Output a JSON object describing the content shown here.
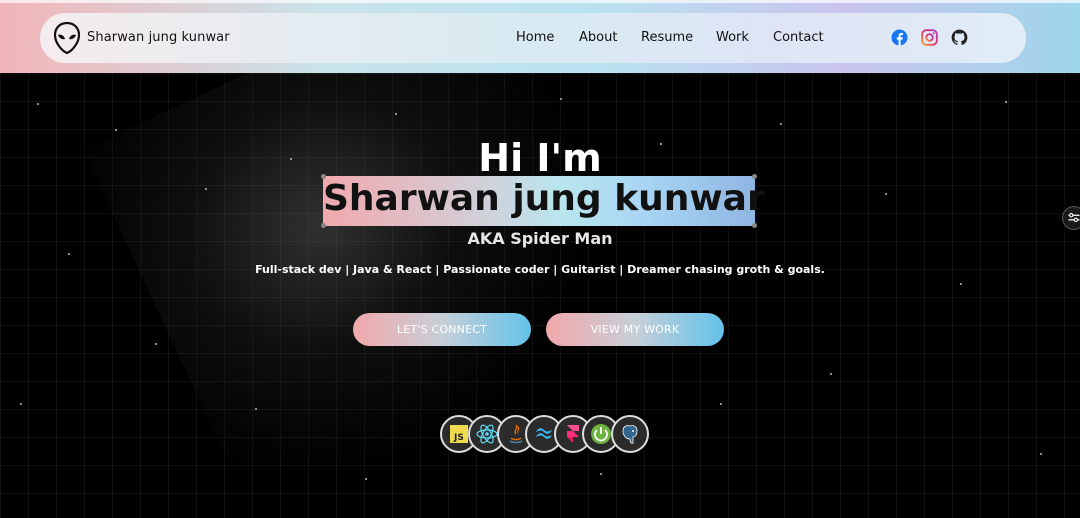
{
  "header": {
    "brand": "Sharwan jung kunwar",
    "nav": [
      "Home",
      "About",
      "Resume",
      "Work",
      "Contact"
    ],
    "social": [
      "facebook-icon",
      "instagram-icon",
      "github-icon"
    ]
  },
  "hero": {
    "greeting": "Hi I'm",
    "name": "Sharwan jung kunwar",
    "aka": "AKA Spider Man",
    "tagline": "Full-stack dev | Java & React | Passionate coder | Guitarist | Dreamer chasing groth & goals.",
    "buttons": {
      "connect": "LET'S CONNECT",
      "work": "VIEW MY WORK"
    },
    "tech_icons": [
      "javascript-icon",
      "react-icon",
      "java-icon",
      "tailwind-icon",
      "framer-icon",
      "spring-icon",
      "postgresql-icon"
    ],
    "js_label": "JS"
  },
  "colors": {
    "accent_pink": "#f1a8ab",
    "accent_blue": "#63c3ea",
    "background": "#000000"
  }
}
